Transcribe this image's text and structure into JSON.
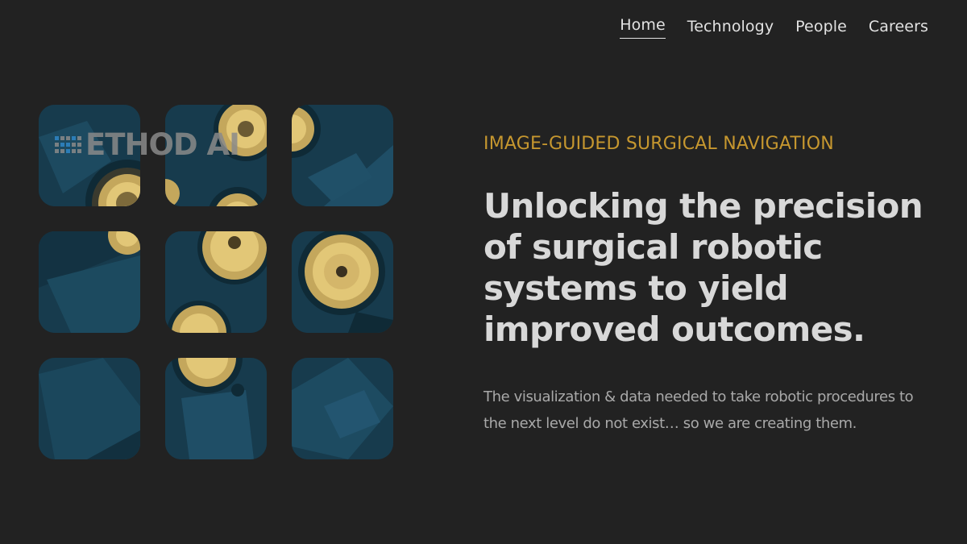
{
  "nav": {
    "items": [
      {
        "label": "Home",
        "active": true
      },
      {
        "label": "Technology",
        "active": false
      },
      {
        "label": "People",
        "active": false
      },
      {
        "label": "Careers",
        "active": false
      }
    ]
  },
  "logo": {
    "text": "ETHOD AI",
    "alt": "METHOD AI"
  },
  "hero": {
    "eyebrow": "IMAGE-GUIDED SURGICAL NAVIGATION",
    "headline": "Unlocking the precision of surgical robotic systems to yield improved outcomes.",
    "subcopy": "The visualization & data needed to take robotic procedures to the next level do not exist… so we are creating them."
  },
  "colors": {
    "background": "#222222",
    "accent": "#c6972f",
    "tile_blue": "#173b4d",
    "lamp": "#e2c777"
  },
  "icons": {
    "logo_mark": "method-ai-logo-icon",
    "tiles": "surgical-lamp-image"
  }
}
